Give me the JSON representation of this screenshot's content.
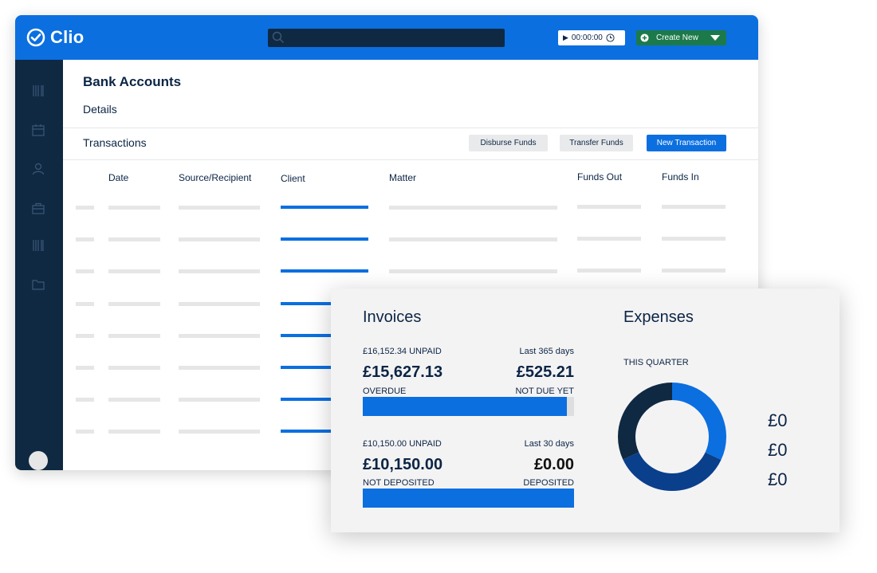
{
  "app": {
    "brand": "Clio",
    "search": {
      "placeholder": ""
    },
    "timer": {
      "time": "00:00:00"
    },
    "create_new_label": "Create New",
    "page_title": "Bank Accounts",
    "details_tab": "Details",
    "transactions_tab": "Transactions",
    "buttons": {
      "disburse": "Disburse Funds",
      "transfer": "Transfer Funds",
      "new_transaction": "New Transaction"
    },
    "columns": [
      "Date",
      "Source/Recipient",
      "Client",
      "Matter",
      "Funds Out",
      "Funds In"
    ],
    "row_count": 8
  },
  "invoices": {
    "title": "Invoices",
    "period1": {
      "unpaid": "£16,152.34 UNPAID",
      "range": "Last 365 days",
      "left_amount": "£15,627.13",
      "right_amount": "£525.21",
      "left_label": "OVERDUE",
      "right_label": "NOT DUE YET",
      "left_fraction": 0.9675
    },
    "period2": {
      "unpaid": "£10,150.00 UNPAID",
      "range": "Last 30 days",
      "left_amount": "£10,150.00",
      "right_amount": "£0.00",
      "left_label": "NOT DEPOSITED",
      "right_label": "DEPOSITED",
      "left_fraction": 1.0
    }
  },
  "expenses": {
    "title": "Expenses",
    "period": "THIS QUARTER",
    "values": [
      "£0",
      "£0",
      "£0"
    ],
    "donut_segments": [
      {
        "fraction": 0.32,
        "color": "#0b6fe0"
      },
      {
        "fraction": 0.36,
        "color": "#0a3f8c"
      },
      {
        "fraction": 0.32,
        "color": "#0f2942"
      }
    ]
  },
  "colors": {
    "brand_blue": "#0b6fe0",
    "navy": "#0f2942",
    "create_green": "#1c7a4a"
  }
}
